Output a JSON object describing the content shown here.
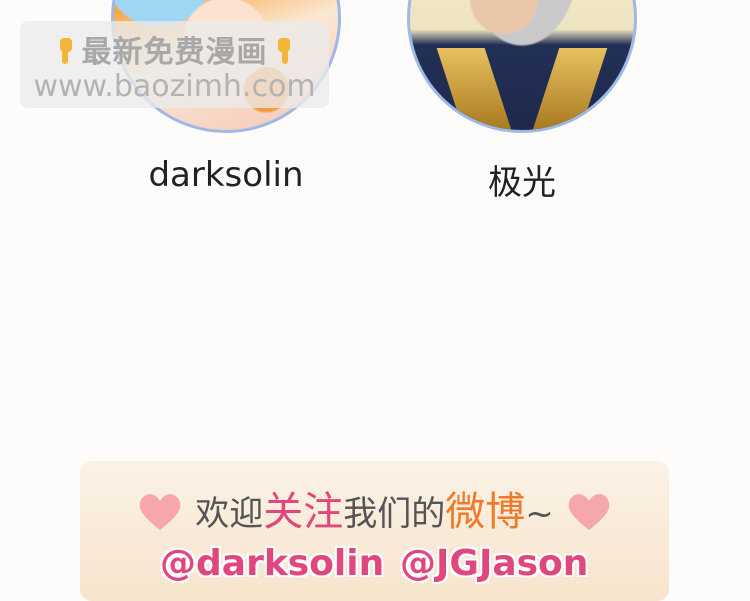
{
  "avatars": [
    {
      "name": "darksolin"
    },
    {
      "name": "极光"
    }
  ],
  "watermark": {
    "line1": "最新免费漫画",
    "line2": "www.baozimh.com",
    "hand_icon": "pointing-down-hand-icon"
  },
  "banner": {
    "prefix": "欢迎",
    "highlight1": "关注",
    "middle": "我们的",
    "highlight2": "微博",
    "suffix": "~",
    "handles": [
      "@darksolin",
      "@JGJason"
    ],
    "colors": {
      "pink": "#e0477c",
      "orange": "#ef7b2a",
      "heart": "#f5a7ab"
    }
  }
}
